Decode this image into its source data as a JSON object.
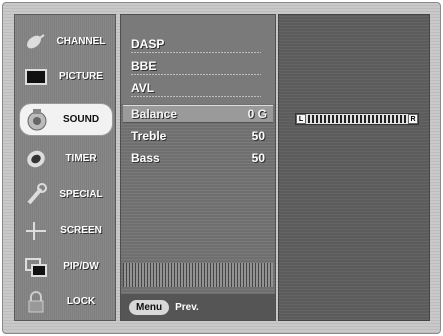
{
  "sidebar": {
    "items": [
      {
        "label": "CHANNEL",
        "icon": "satellite-dish-icon",
        "active": false
      },
      {
        "label": "PICTURE",
        "icon": "picture-monitor-icon",
        "active": false
      },
      {
        "label": "SOUND",
        "icon": "speaker-icon",
        "active": true
      },
      {
        "label": "TIMER",
        "icon": "clock-icon",
        "active": false
      },
      {
        "label": "SPECIAL",
        "icon": "wrench-icon",
        "active": false
      },
      {
        "label": "SCREEN",
        "icon": "crosshair-icon",
        "active": false
      },
      {
        "label": "PIP/DW",
        "icon": "pip-windows-icon",
        "active": false
      },
      {
        "label": "LOCK",
        "icon": "padlock-icon",
        "active": false
      }
    ]
  },
  "sound_menu": {
    "items": [
      {
        "label": "DASP",
        "value": ""
      },
      {
        "label": "BBE",
        "value": ""
      },
      {
        "label": "AVL",
        "value": ""
      },
      {
        "label": "Balance",
        "value": "0 G"
      },
      {
        "label": "Treble",
        "value": "50"
      },
      {
        "label": "Bass",
        "value": "50"
      }
    ]
  },
  "footer": {
    "menu_label": "Menu",
    "prev_label": "Prev."
  },
  "balance_slider": {
    "left_label": "L",
    "right_label": "R"
  }
}
